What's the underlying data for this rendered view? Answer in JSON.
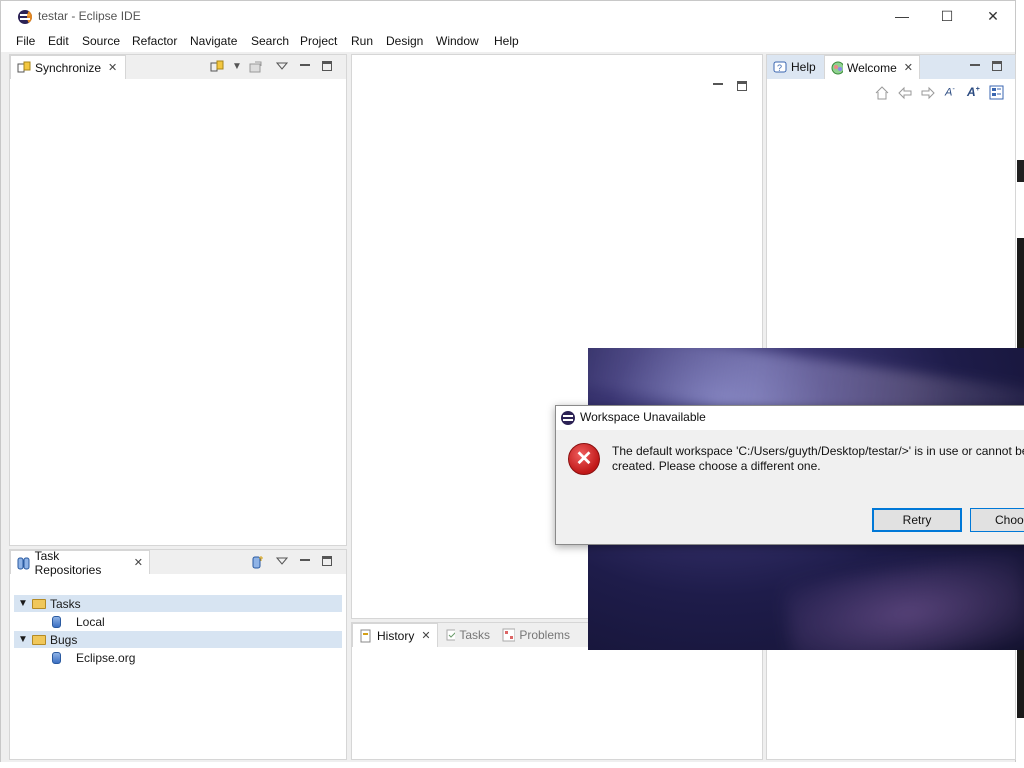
{
  "window": {
    "title": "testar - Eclipse IDE",
    "minimize_glyph": "—",
    "maximize_glyph": "☐",
    "close_glyph": "✕"
  },
  "menu": [
    "File",
    "Edit",
    "Source",
    "Refactor",
    "Navigate",
    "Search",
    "Project",
    "Run",
    "Design",
    "Window",
    "Help"
  ],
  "synchronize_view": {
    "tab_label": "Synchronize",
    "close_glyph": "✕"
  },
  "task_repositories_view": {
    "tab_label": "Task Repositories",
    "close_glyph": "✕",
    "tree": [
      {
        "label": "Tasks",
        "children": [
          "Local"
        ]
      },
      {
        "label": "Bugs",
        "children": [
          "Eclipse.org"
        ]
      }
    ]
  },
  "help_view": {
    "tabs": [
      "Help",
      "Welcome"
    ],
    "active_tab": "Welcome",
    "close_glyph": "✕"
  },
  "bottom_view": {
    "tabs": [
      "History",
      "Tasks",
      "Problems"
    ],
    "active_tab": "History",
    "close_glyph": "✕"
  },
  "dialog": {
    "title": "Workspace Unavailable",
    "message": "The default workspace 'C:/Users/guyth/Desktop/testar/>' is in use or cannot be\ncreated. Please choose a different one.",
    "retry_label": "Retry",
    "choose_label": "Choose"
  },
  "icons": {
    "error": "error-icon",
    "app": "eclipse-icon"
  },
  "colors": {
    "tree_highlight": "#d7e4f2",
    "dialog_button_border": "#0078d7",
    "error_red": "#c01818"
  }
}
